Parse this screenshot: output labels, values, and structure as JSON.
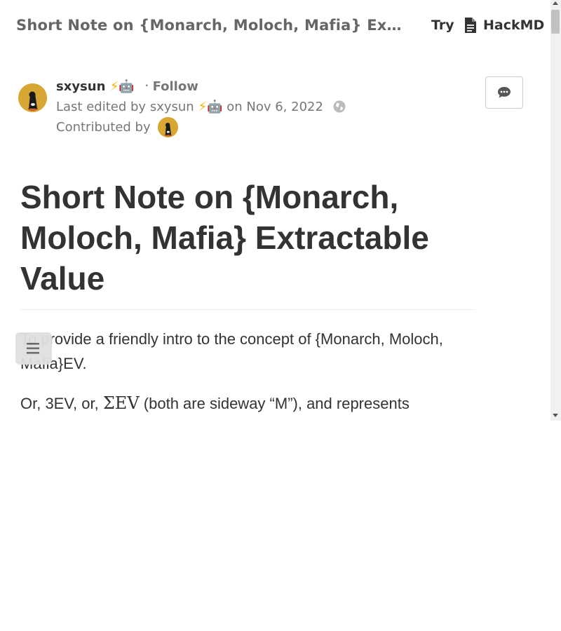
{
  "header": {
    "title": "Short Note on {Monarch, Moloch, Mafia} Ex…",
    "try_label": "Try",
    "brand_label": "HackMD"
  },
  "meta": {
    "author": "sxysun",
    "author_emojis": [
      "⚡",
      "🤖"
    ],
    "follow_label": "Follow",
    "last_edited_prefix": "Last edited by",
    "last_edited_user": "sxysun",
    "last_edited_suffix": "on Nov 6, 2022",
    "contributed_label": "Contributed by"
  },
  "content": {
    "heading": "Short Note on {Monarch, Moloch, Mafia} Extractable Value",
    "paragraph1": "To provide a friendly intro to the concept of {Monarch, Moloch, Mafia}EV.",
    "paragraph2_start": "Or, 3EV, or,",
    "paragraph2_math": "ΣEV",
    "paragraph2_end": "(both are sideway “M”), and represents"
  },
  "icons": [
    "document-icon",
    "globe-icon",
    "comment-icon",
    "table-of-contents-icon"
  ],
  "colors": {
    "text": "#333333",
    "muted": "#777777",
    "bolt": "#f4b400",
    "avatar_bg": "#d4a02e"
  }
}
